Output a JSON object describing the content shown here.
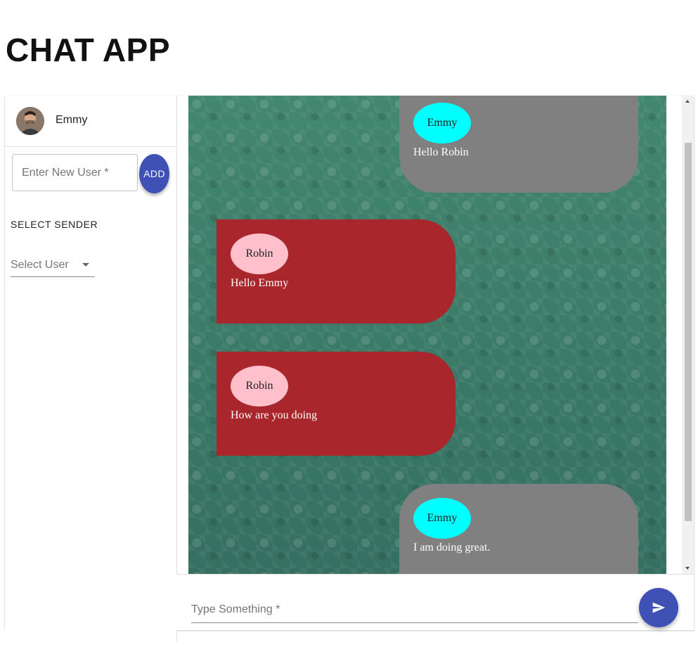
{
  "app": {
    "title": "CHAT APP"
  },
  "sidebar": {
    "current_user": {
      "name": "Emmy",
      "avatar_icon": "user-avatar"
    },
    "new_user": {
      "placeholder": "Enter New User *",
      "add_label": "ADD"
    },
    "select_sender": {
      "label": "SELECT SENDER",
      "value": "Select User"
    }
  },
  "messages": [
    {
      "sender": "Emmy",
      "text": "Hello Robin",
      "side": "right"
    },
    {
      "sender": "Robin",
      "text": "Hello Emmy",
      "side": "left"
    },
    {
      "sender": "Robin",
      "text": "How are you doing",
      "side": "left"
    },
    {
      "sender": "Emmy",
      "text": "I am doing great.",
      "side": "right"
    }
  ],
  "composer": {
    "placeholder": "Type Something *",
    "send_icon": "send-icon"
  },
  "colors": {
    "accent": "#3f51b5",
    "left_bubble": "#a8262c",
    "right_bubble": "#808080",
    "left_sender": "#ffc0cb",
    "right_sender": "#00ffff",
    "chat_background": "#3a7d6e"
  }
}
